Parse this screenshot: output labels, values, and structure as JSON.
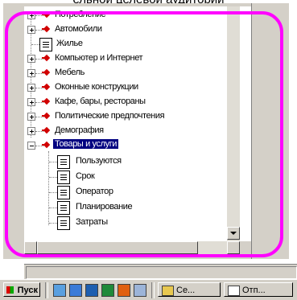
{
  "header_text": "ельной целевой аудитории",
  "tree": {
    "items": [
      {
        "label": "Потребление",
        "expander": "plus",
        "icon": "red-diamond-icon"
      },
      {
        "label": "Автомобили",
        "expander": "plus",
        "icon": "red-diamond-icon"
      },
      {
        "label": "Жилье",
        "expander": "none",
        "icon": "document-icon"
      },
      {
        "label": "Компьютер и Интернет",
        "expander": "plus",
        "icon": "red-diamond-icon"
      },
      {
        "label": "Мебель",
        "expander": "plus",
        "icon": "red-diamond-icon"
      },
      {
        "label": "Оконные конструкции",
        "expander": "plus",
        "icon": "red-diamond-icon"
      },
      {
        "label": "Кафе, бары, рестораны",
        "expander": "plus",
        "icon": "red-diamond-icon"
      },
      {
        "label": "Политические предпочтения",
        "expander": "plus",
        "icon": "red-diamond-icon"
      },
      {
        "label": "Демография",
        "expander": "plus",
        "icon": "red-diamond-icon"
      },
      {
        "label": "Товары и услуги",
        "expander": "minus",
        "icon": "red-diamond-icon",
        "selected": true
      },
      {
        "label": "Пользуются",
        "child": true,
        "icon": "document-icon"
      },
      {
        "label": "Срок",
        "child": true,
        "icon": "document-icon"
      },
      {
        "label": "Оператор",
        "child": true,
        "icon": "document-icon"
      },
      {
        "label": "Планирование",
        "child": true,
        "icon": "document-icon"
      },
      {
        "label": "Затраты",
        "child": true,
        "icon": "document-icon"
      }
    ]
  },
  "taskbar": {
    "start_label": "Пуск",
    "quick_launch": [
      "desktop-icon",
      "browser-icon",
      "app-icon",
      "excel-icon",
      "office-icon",
      "window-icon"
    ],
    "tasks": [
      {
        "label": "Се...",
        "icon": "folder-icon"
      },
      {
        "label": "Отп...",
        "icon": "document-icon"
      }
    ]
  },
  "colors": {
    "highlight_ring": "#ff00ff",
    "selection": "#000080",
    "category_icon": "#d10000"
  }
}
